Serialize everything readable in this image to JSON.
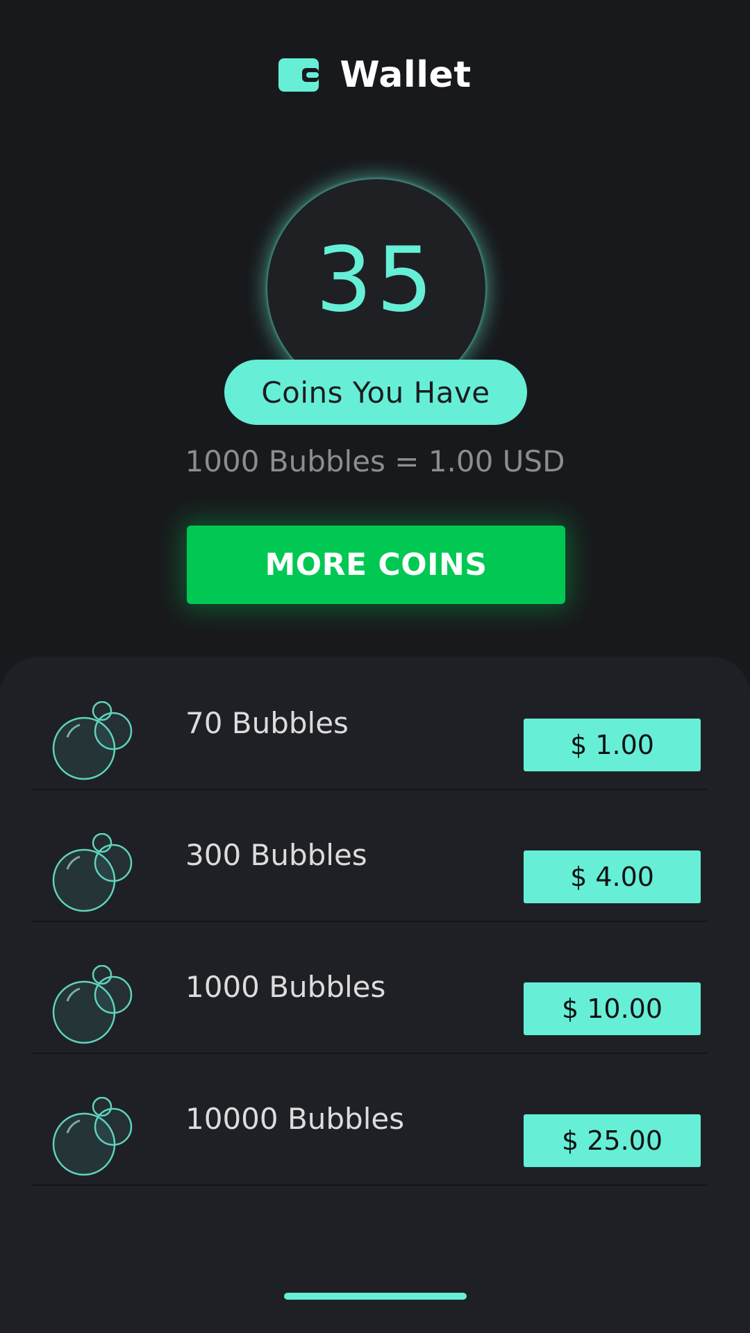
{
  "header": {
    "title": "Wallet",
    "icon": "wallet-icon"
  },
  "balance": {
    "value": "35",
    "label": "Coins You Have",
    "rate": "1000 Bubbles = 1.00 USD"
  },
  "more_coins_button": {
    "label": "MORE COINS"
  },
  "packages": [
    {
      "label": "70 Bubbles",
      "price": "$ 1.00"
    },
    {
      "label": "300 Bubbles",
      "price": "$ 4.00"
    },
    {
      "label": "1000 Bubbles",
      "price": "$ 10.00"
    },
    {
      "label": "10000 Bubbles",
      "price": "$ 25.00"
    }
  ],
  "colors": {
    "background": "#18191c",
    "panel": "#1f2025",
    "accent": "#66efd6",
    "button_green": "#00c853",
    "muted_text": "#8c8d90"
  }
}
